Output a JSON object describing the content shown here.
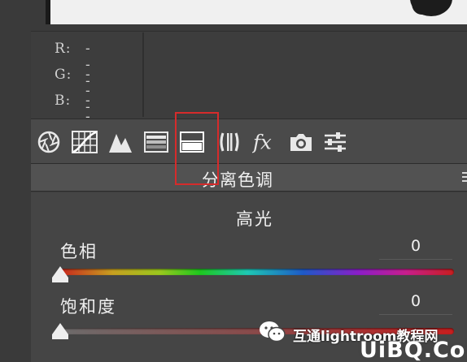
{
  "rgb_readout": [
    {
      "channel": "R:",
      "value": "---"
    },
    {
      "channel": "G:",
      "value": "---"
    },
    {
      "channel": "B:",
      "value": "---"
    }
  ],
  "toolbar": {
    "tools": [
      {
        "name": "basic-tool-icon"
      },
      {
        "name": "tone-curve-tool-icon"
      },
      {
        "name": "detail-tool-icon"
      },
      {
        "name": "hsl-tool-icon"
      },
      {
        "name": "split-toning-tool-icon",
        "selected": true
      },
      {
        "name": "lens-corrections-tool-icon"
      },
      {
        "name": "effects-tool-icon",
        "label": "fx"
      },
      {
        "name": "camera-calibration-tool-icon"
      },
      {
        "name": "presets-tool-icon"
      }
    ],
    "highlight_color": "#d62b2b"
  },
  "section": {
    "title": "分离色调"
  },
  "highlights": {
    "title": "高光",
    "hue": {
      "label": "色相",
      "value": "0",
      "level": 0
    },
    "saturation": {
      "label": "饱和度",
      "value": "0",
      "level": 0
    }
  },
  "watermark": {
    "text": "互通lightroom教程网",
    "site": "UiBQ.CoM"
  },
  "colors": {
    "panel_bg": "#454545",
    "toolbar_bg": "#4a4a4a",
    "header_bg": "#525252",
    "accent_red": "#d62b2b"
  }
}
